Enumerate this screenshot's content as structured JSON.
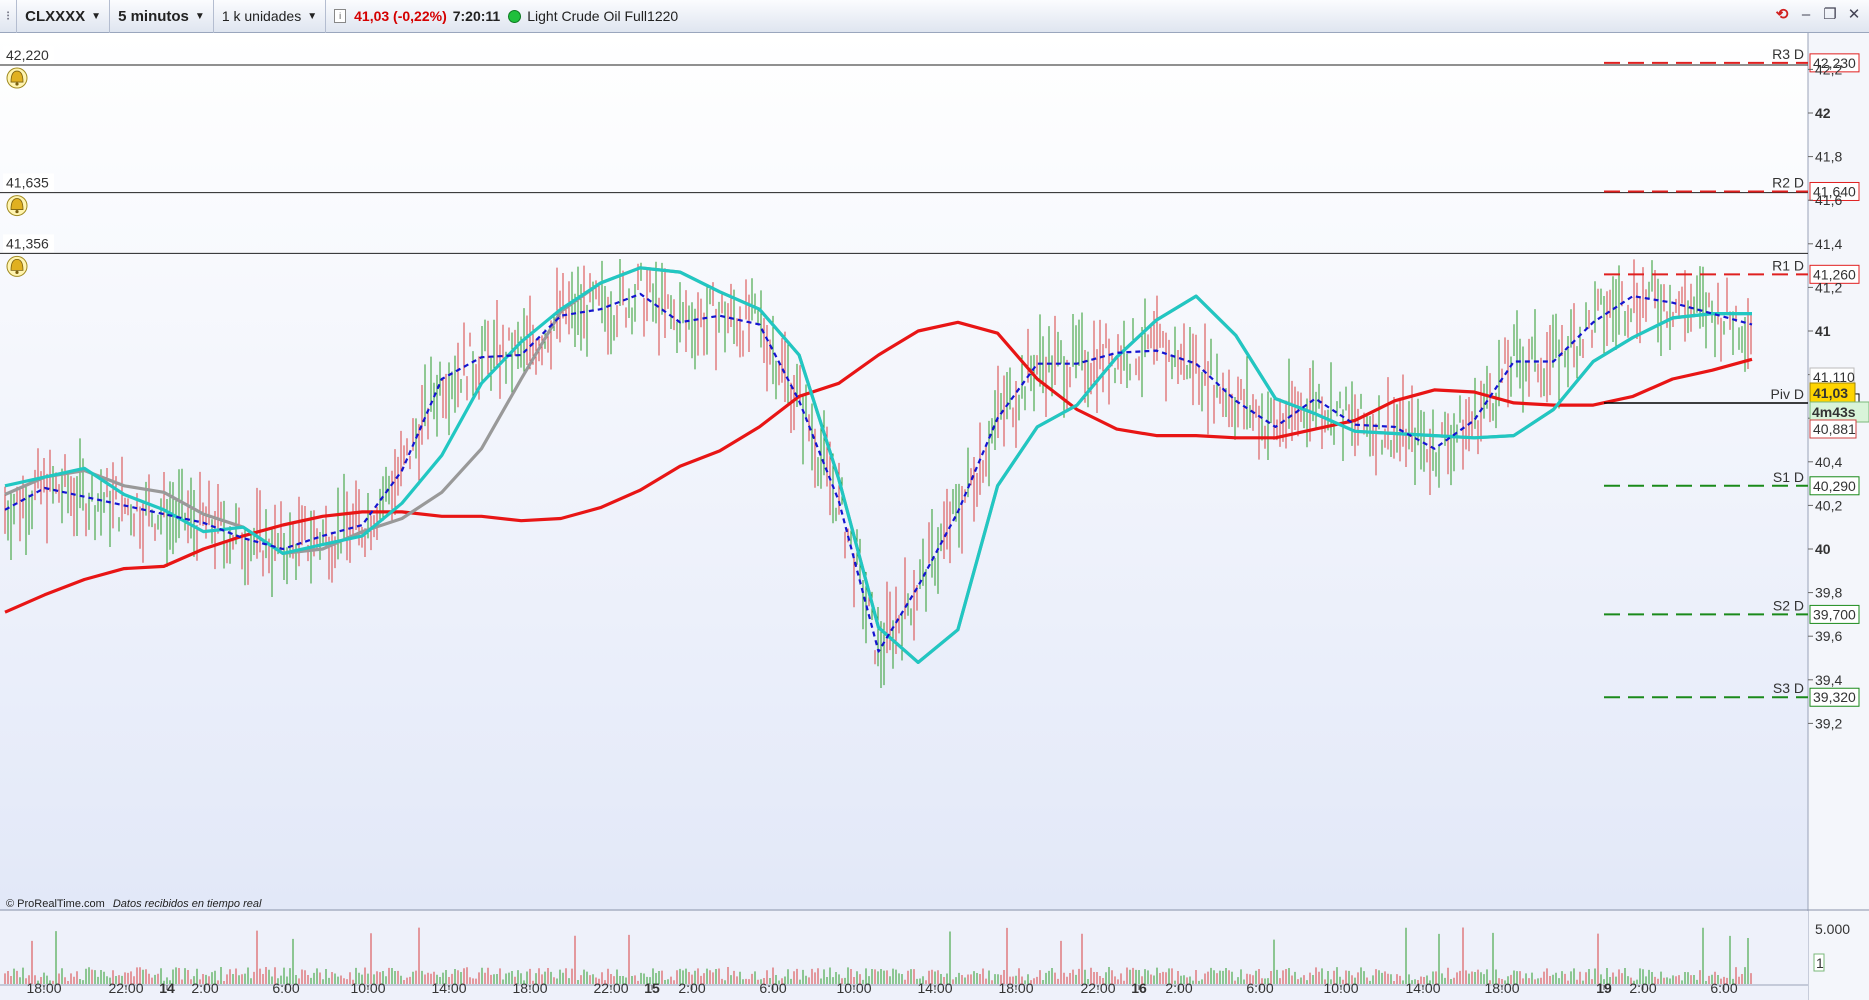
{
  "toolbar": {
    "symbol": "CLXXXX",
    "timeframe": "5 minutos",
    "units": "1 k unidades",
    "price_change": "41,03 (-0,22%)",
    "time": "7:20:11",
    "instrument": "Light Crude Oil Full1220"
  },
  "alerts": [
    {
      "label": "42,220",
      "price": 42.22
    },
    {
      "label": "41,635",
      "price": 41.635
    },
    {
      "label": "41,356",
      "price": 41.356
    }
  ],
  "pivots": [
    {
      "name": "R3 D",
      "value": 42.23,
      "label": "42,230",
      "color": "#e02020"
    },
    {
      "name": "R2 D",
      "value": 41.64,
      "label": "41,640",
      "color": "#e02020"
    },
    {
      "name": "R1 D",
      "value": 41.26,
      "label": "41,260",
      "color": "#e02020"
    },
    {
      "name": "Piv D",
      "value": 40.67,
      "label": "40,670",
      "color": "#000000"
    },
    {
      "name": "S1 D",
      "value": 40.29,
      "label": "40,290",
      "color": "#1a8a1a"
    },
    {
      "name": "S2 D",
      "value": 39.7,
      "label": "39,700",
      "color": "#1a8a1a"
    },
    {
      "name": "S3 D",
      "value": 39.32,
      "label": "39,320",
      "color": "#1a8a1a"
    }
  ],
  "price_tags": {
    "last": "41,03",
    "countdown": "4m43s",
    "grey_level": "41,110",
    "red_level": "40,881"
  },
  "credit": {
    "source": "© ProRealTime.com",
    "note": "Datos recibidos en tiempo real"
  },
  "volume_axis": {
    "top": "5.000",
    "bottom": "1"
  },
  "chart_data": {
    "type": "line",
    "y_axis_ticks": [
      "39,2",
      "39,4",
      "39,6",
      "39,8",
      "40",
      "40,2",
      "40,4",
      "40,6",
      "40,8",
      "41",
      "41,2",
      "41,4",
      "41,6",
      "41,8",
      "42",
      "42,2"
    ],
    "ylim": [
      39.1,
      42.35
    ],
    "x_axis_ticks": [
      "18:00",
      "22:00",
      "14",
      "2:00",
      "6:00",
      "10:00",
      "14:00",
      "18:00",
      "22:00",
      "15",
      "2:00",
      "6:00",
      "10:00",
      "14:00",
      "18:00",
      "22:00",
      "16",
      "2:00",
      "6:00",
      "10:00",
      "14:00",
      "18:00",
      "19",
      "2:00",
      "6:00"
    ],
    "day_ticks": [
      "14",
      "15",
      "16",
      "19"
    ],
    "series": [
      {
        "color": "#e81515",
        "style": "solid",
        "values": [
          39.71,
          39.79,
          39.86,
          39.91,
          39.92,
          40.0,
          40.06,
          40.11,
          40.15,
          40.17,
          40.17,
          40.15,
          40.15,
          40.13,
          40.14,
          40.19,
          40.27,
          40.38,
          40.45,
          40.56,
          40.7,
          40.76,
          40.89,
          41.0,
          41.04,
          40.99,
          40.78,
          40.64,
          40.55,
          40.52,
          40.52,
          40.51,
          40.51,
          40.55,
          40.59,
          40.68,
          40.73,
          40.72,
          40.67,
          40.66,
          40.66,
          40.7,
          40.78,
          40.82,
          40.87
        ]
      },
      {
        "color": "#999999",
        "style": "solid",
        "values": [
          40.25,
          40.33,
          40.36,
          40.29,
          40.26,
          40.16,
          40.1,
          39.98,
          40.0,
          40.08,
          40.14,
          40.26,
          40.46,
          40.78,
          41.09,
          41.22,
          41.29,
          41.27,
          41.18,
          41.1,
          40.89,
          40.32,
          39.64,
          39.48,
          39.63,
          40.29,
          40.56,
          40.66,
          40.88,
          41.05,
          41.16,
          40.98,
          40.69,
          40.62,
          40.54,
          40.53,
          40.52,
          40.51,
          40.52,
          40.64,
          40.86,
          40.97,
          41.06,
          41.08,
          41.08
        ]
      },
      {
        "color": "#21c7c2",
        "style": "solid",
        "values": [
          40.29,
          40.33,
          40.37,
          40.25,
          40.18,
          40.08,
          40.1,
          39.98,
          40.02,
          40.06,
          40.21,
          40.43,
          40.76,
          40.95,
          41.1,
          41.22,
          41.29,
          41.27,
          41.18,
          41.1,
          40.89,
          40.32,
          39.64,
          39.48,
          39.63,
          40.29,
          40.56,
          40.66,
          40.88,
          41.05,
          41.16,
          40.98,
          40.69,
          40.62,
          40.54,
          40.53,
          40.52,
          40.51,
          40.52,
          40.64,
          40.86,
          40.97,
          41.06,
          41.08,
          41.08
        ]
      },
      {
        "color": "#1414d0",
        "style": "dashed",
        "values": [
          40.18,
          40.28,
          40.24,
          40.2,
          40.16,
          40.12,
          40.05,
          40.0,
          40.06,
          40.11,
          40.36,
          40.78,
          40.88,
          40.89,
          41.07,
          41.1,
          41.17,
          41.04,
          41.07,
          41.03,
          40.68,
          40.22,
          39.53,
          39.83,
          40.17,
          40.6,
          40.85,
          40.85,
          40.9,
          40.91,
          40.85,
          40.68,
          40.56,
          40.69,
          40.57,
          40.56,
          40.46,
          40.59,
          40.86,
          40.86,
          41.04,
          41.16,
          41.13,
          41.08,
          41.03
        ]
      }
    ]
  }
}
